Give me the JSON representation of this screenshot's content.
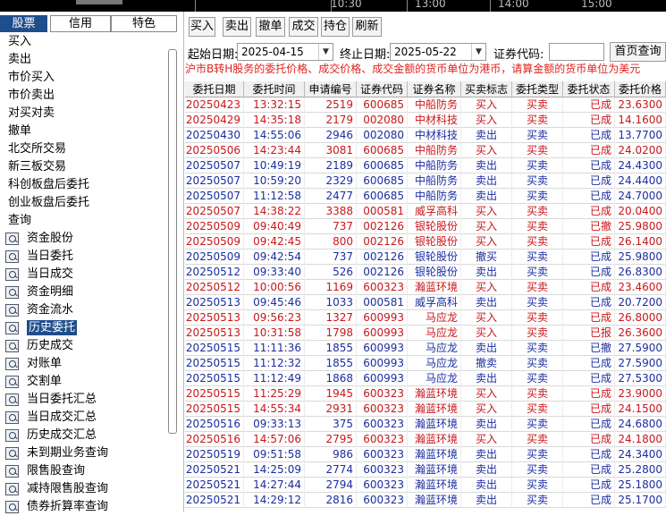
{
  "top_strip": {
    "times": [
      "10:30",
      "13:00",
      "14:00",
      "15:00"
    ]
  },
  "left_tabs": [
    "股票",
    "信用",
    "特色"
  ],
  "menu": [
    {
      "label": "买入"
    },
    {
      "label": "卖出"
    },
    {
      "label": "市价买入"
    },
    {
      "label": "市价卖出"
    },
    {
      "label": "对买对卖"
    },
    {
      "label": "撤单"
    },
    {
      "label": "北交所交易"
    },
    {
      "label": "新三板交易"
    },
    {
      "label": "科创板盘后委托"
    },
    {
      "label": "创业板盘后委托"
    },
    {
      "label": "查询"
    },
    {
      "label": "资金股份",
      "icon": "search-doc-icon"
    },
    {
      "label": "当日委托",
      "icon": "search-doc-icon"
    },
    {
      "label": "当日成交",
      "icon": "search-doc-icon"
    },
    {
      "label": "资金明细",
      "icon": "search-doc-icon"
    },
    {
      "label": "资金流水",
      "icon": "search-doc-icon"
    },
    {
      "label": "历史委托",
      "icon": "search-doc-icon",
      "selected": true
    },
    {
      "label": "历史成交",
      "icon": "search-doc-icon"
    },
    {
      "label": "对账单",
      "icon": "search-doc-icon"
    },
    {
      "label": "交割单",
      "icon": "search-doc-icon"
    },
    {
      "label": "当日委托汇总",
      "icon": "search-doc-icon"
    },
    {
      "label": "当日成交汇总",
      "icon": "search-doc-icon"
    },
    {
      "label": "历史成交汇总",
      "icon": "search-doc-icon"
    },
    {
      "label": "未到期业务查询",
      "icon": "search-doc-icon"
    },
    {
      "label": "限售股查询",
      "icon": "search-doc-icon"
    },
    {
      "label": "减持限售股查询",
      "icon": "search-doc-icon"
    },
    {
      "label": "债券折算率查询",
      "icon": "search-doc-icon"
    }
  ],
  "toolbar": [
    "买入",
    "卖出",
    "撤单",
    "成交",
    "持仓",
    "刷新"
  ],
  "filters": {
    "start_label": "起始日期:",
    "start_value": "2025-04-15",
    "end_label": "终止日期:",
    "end_value": "2025-05-22",
    "code_label": "证券代码:",
    "code_value": "",
    "home_button": "首页查询"
  },
  "notice": "沪市B转H股务的委托价格、成交价格、成交金额的货币单位为港币，请算金额的货币单位为美元",
  "columns": [
    "委托日期",
    "委托时间",
    "申请编号",
    "证券代码",
    "证券名称",
    "买卖标志",
    "委托类型",
    "委托状态",
    "委托价格"
  ],
  "colors": {
    "buy": "#c8171b",
    "sell": "#1b2da0",
    "accent": "#1f4e8c"
  },
  "rows": [
    [
      "20250423",
      "13:32:15",
      "2519",
      "600685",
      "中船防务",
      "买入",
      "买卖",
      "已成",
      "23.6300"
    ],
    [
      "20250429",
      "14:35:18",
      "2179",
      "002080",
      "中材科技",
      "买入",
      "买卖",
      "已成",
      "14.1600"
    ],
    [
      "20250430",
      "14:55:06",
      "2946",
      "002080",
      "中材科技",
      "卖出",
      "买卖",
      "已成",
      "13.7700"
    ],
    [
      "20250506",
      "14:23:44",
      "3081",
      "600685",
      "中船防务",
      "买入",
      "买卖",
      "已成",
      "24.0200"
    ],
    [
      "20250507",
      "10:49:19",
      "2189",
      "600685",
      "中船防务",
      "卖出",
      "买卖",
      "已成",
      "24.4300"
    ],
    [
      "20250507",
      "10:59:20",
      "2329",
      "600685",
      "中船防务",
      "卖出",
      "买卖",
      "已成",
      "24.4400"
    ],
    [
      "20250507",
      "11:12:58",
      "2477",
      "600685",
      "中船防务",
      "卖出",
      "买卖",
      "已成",
      "24.7000"
    ],
    [
      "20250507",
      "14:38:22",
      "3388",
      "000581",
      "威孚高科",
      "买入",
      "买卖",
      "已成",
      "20.0400"
    ],
    [
      "20250509",
      "09:40:49",
      "737",
      "002126",
      "银轮股份",
      "买入",
      "买卖",
      "已撤",
      "25.9800"
    ],
    [
      "20250509",
      "09:42:45",
      "800",
      "002126",
      "银轮股份",
      "买入",
      "买卖",
      "已成",
      "26.1400"
    ],
    [
      "20250509",
      "09:42:54",
      "737",
      "002126",
      "银轮股份",
      "撤买",
      "买卖",
      "已成",
      "25.9800"
    ],
    [
      "20250512",
      "09:33:40",
      "526",
      "002126",
      "银轮股份",
      "卖出",
      "买卖",
      "已成",
      "26.8300"
    ],
    [
      "20250512",
      "10:00:56",
      "1169",
      "600323",
      "瀚蓝环境",
      "买入",
      "买卖",
      "已成",
      "23.4600"
    ],
    [
      "20250513",
      "09:45:46",
      "1033",
      "000581",
      "威孚高科",
      "卖出",
      "买卖",
      "已成",
      "20.7200"
    ],
    [
      "20250513",
      "09:56:23",
      "1327",
      "600993",
      "马应龙",
      "买入",
      "买卖",
      "已成",
      "26.8000"
    ],
    [
      "20250513",
      "10:31:58",
      "1798",
      "600993",
      "马应龙",
      "买入",
      "买卖",
      "已报",
      "26.3600"
    ],
    [
      "20250515",
      "11:11:36",
      "1855",
      "600993",
      "马应龙",
      "卖出",
      "买卖",
      "已撤",
      "27.5900"
    ],
    [
      "20250515",
      "11:12:32",
      "1855",
      "600993",
      "马应龙",
      "撤卖",
      "买卖",
      "已成",
      "27.5900"
    ],
    [
      "20250515",
      "11:12:49",
      "1868",
      "600993",
      "马应龙",
      "卖出",
      "买卖",
      "已成",
      "27.5300"
    ],
    [
      "20250515",
      "11:25:29",
      "1945",
      "600323",
      "瀚蓝环境",
      "买入",
      "买卖",
      "已成",
      "23.9000"
    ],
    [
      "20250515",
      "14:55:34",
      "2931",
      "600323",
      "瀚蓝环境",
      "买入",
      "买卖",
      "已成",
      "24.1500"
    ],
    [
      "20250516",
      "09:33:13",
      "375",
      "600323",
      "瀚蓝环境",
      "卖出",
      "买卖",
      "已成",
      "24.6800"
    ],
    [
      "20250516",
      "14:57:06",
      "2795",
      "600323",
      "瀚蓝环境",
      "买入",
      "买卖",
      "已成",
      "24.1800"
    ],
    [
      "20250519",
      "09:51:58",
      "986",
      "600323",
      "瀚蓝环境",
      "卖出",
      "买卖",
      "已成",
      "24.3400"
    ],
    [
      "20250521",
      "14:25:09",
      "2774",
      "600323",
      "瀚蓝环境",
      "卖出",
      "买卖",
      "已成",
      "25.2800"
    ],
    [
      "20250521",
      "14:27:44",
      "2794",
      "600323",
      "瀚蓝环境",
      "卖出",
      "买卖",
      "已成",
      "25.1800"
    ],
    [
      "20250521",
      "14:29:12",
      "2816",
      "600323",
      "瀚蓝环境",
      "卖出",
      "买卖",
      "已成",
      "25.1700"
    ]
  ]
}
